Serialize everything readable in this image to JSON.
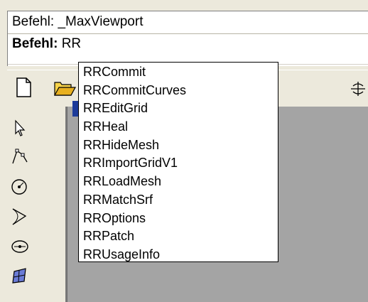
{
  "command": {
    "history_label": "Befehl:",
    "history_value": "_MaxViewport",
    "prompt_label": "Befehl:",
    "prompt_value": "RR"
  },
  "toolbar": {
    "icons": [
      "new-document-icon",
      "open-folder-icon",
      "rotate-view-icon"
    ]
  },
  "side_toolbar": {
    "icons": [
      "select-arrow-icon",
      "polyline-icon",
      "circle-icon",
      "curve-icon",
      "ellipse-icon",
      "surface-icon"
    ]
  },
  "autocomplete": {
    "items": [
      "RRCommit",
      "RRCommitCurves",
      "RREditGrid",
      "RRHeal",
      "RRHideMesh",
      "RRImportGridV1",
      "RRLoadMesh",
      "RRMatchSrf",
      "RROptions",
      "RRPatch",
      "RRUsageInfo"
    ]
  },
  "colors": {
    "window": "#ece9dc",
    "viewport": "#a4a4a4",
    "popup_bg": "#ffffff"
  }
}
